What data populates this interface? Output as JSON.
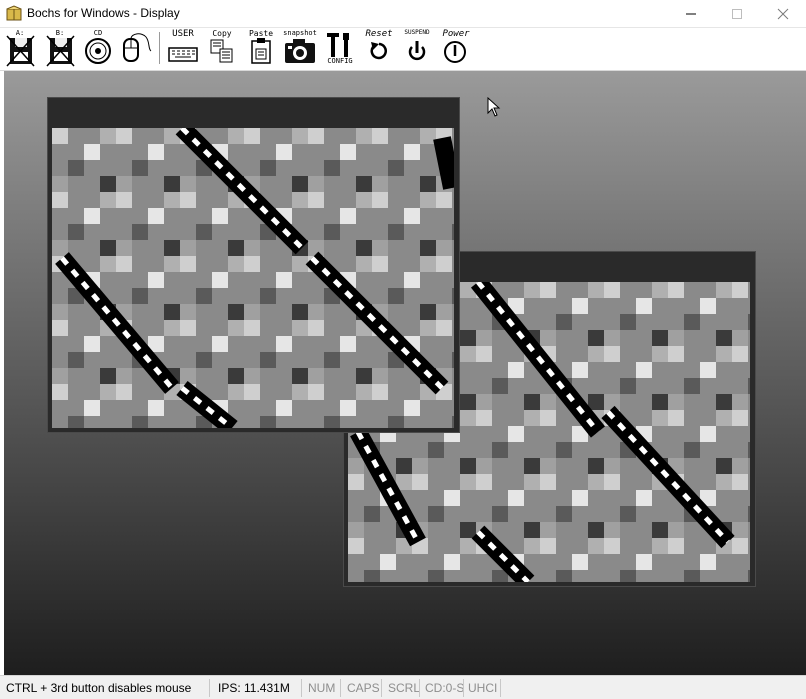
{
  "window": {
    "title": "Bochs for Windows - Display"
  },
  "toolbar": {
    "floppy_a": "A:",
    "floppy_b": "B:",
    "cdrom": "CD",
    "user": "USER",
    "copy": "Copy",
    "paste": "Paste",
    "snapshot": "snapshot",
    "config": "CONFIG",
    "reset": "Reset",
    "suspend": "SUSPEND",
    "power": "Power"
  },
  "status": {
    "hint": "CTRL + 3rd button disables mouse",
    "ips": "IPS: 11.431M",
    "num": "NUM",
    "caps": "CAPS",
    "scrl": "SCRL",
    "cd": "CD:0-S",
    "uhci": "UHCI"
  },
  "colors": {
    "display_top": "#9a9a9a",
    "display_bottom": "#1e1e1e",
    "panel": "#2a2a2a"
  },
  "icons": [
    "floppy-a-icon",
    "floppy-b-icon",
    "cdrom-icon",
    "mouse-icon",
    "keyboard-icon",
    "copy-icon",
    "paste-icon",
    "camera-icon",
    "config-icon",
    "reset-icon",
    "suspend-icon",
    "power-icon",
    "mouse-cursor-icon"
  ]
}
